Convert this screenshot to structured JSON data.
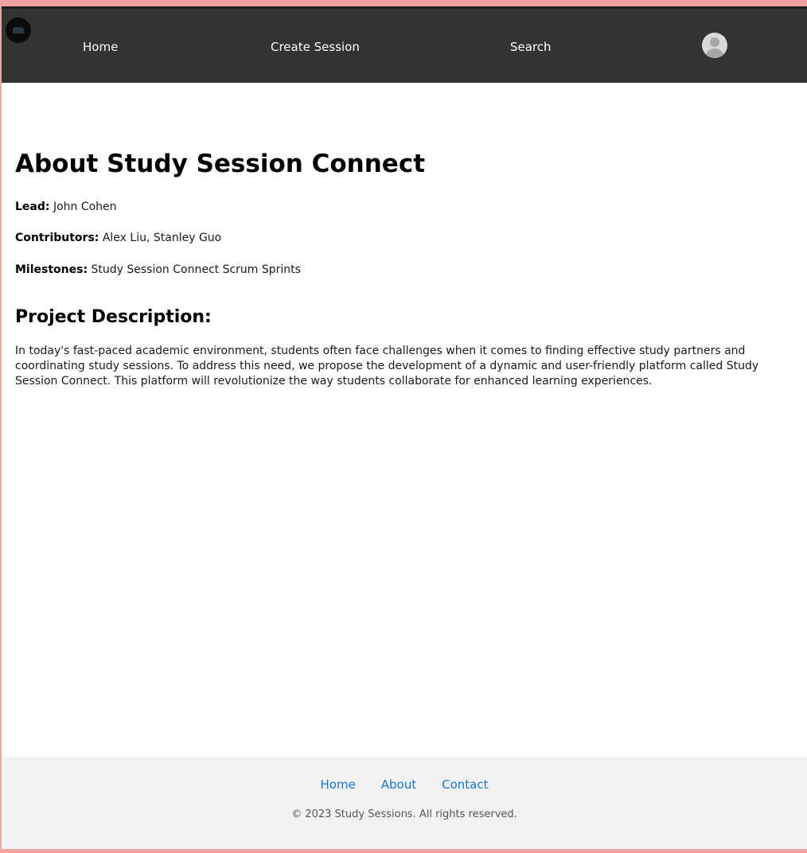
{
  "navbar": {
    "logo_icon": "study-session-logo-icon",
    "links": [
      {
        "label": "Home"
      },
      {
        "label": "Create Session"
      },
      {
        "label": "Search"
      }
    ],
    "avatar_icon": "user-avatar-icon",
    "background": "#333333"
  },
  "main": {
    "title": "About Study Session Connect",
    "lead": {
      "label": "Lead:",
      "value": "John Cohen"
    },
    "contributors": {
      "label": "Contributors:",
      "value": "Alex Liu, Stanley Guo"
    },
    "milestones": {
      "label": "Milestones:",
      "value": "Study Session Connect Scrum Sprints"
    },
    "section_title": "Project Description:",
    "description": "In today's fast-paced academic environment, students often face challenges when it comes to finding effective study partners and coordinating study sessions. To address this need, we propose the development of a dynamic and user-friendly platform called Study Session Connect. This platform will revolutionize the way students collaborate for enhanced learning experiences."
  },
  "footer": {
    "links": [
      {
        "label": "Home"
      },
      {
        "label": "About"
      },
      {
        "label": "Contact"
      }
    ],
    "copyright": "© 2023 Study Sessions. All rights reserved.",
    "link_color": "#1a73d9"
  }
}
